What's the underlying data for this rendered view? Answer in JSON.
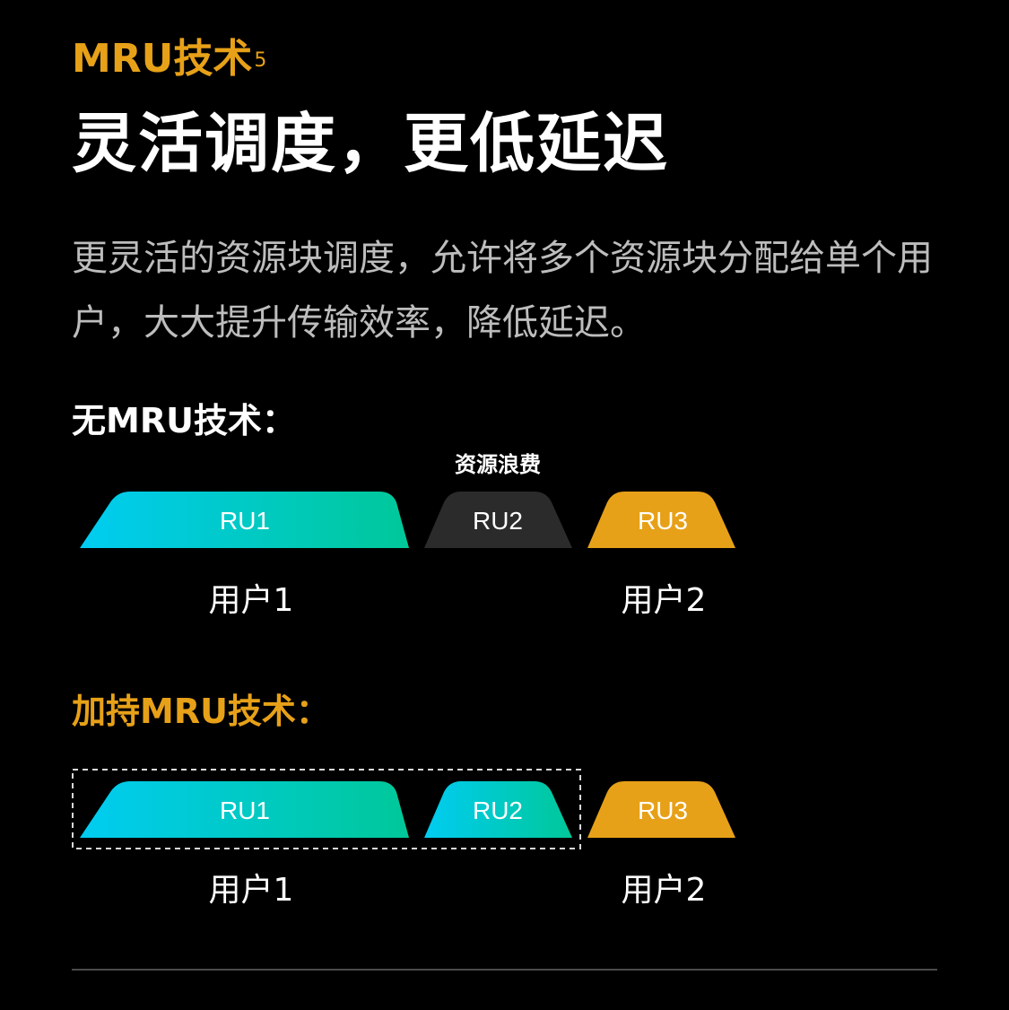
{
  "header": {
    "eyebrow": "MRU技术",
    "eyebrow_sup": "5",
    "headline": "灵活调度，更低延迟",
    "body": "更灵活的资源块调度，允许将多个资源块分配给单个用户，大大提升传输效率，降低延迟。"
  },
  "without_mru": {
    "title": "无MRU技术：",
    "waste_label": "资源浪费",
    "blocks": [
      {
        "label": "RU1",
        "style": "gradient"
      },
      {
        "label": "RU2",
        "style": "gray"
      },
      {
        "label": "RU3",
        "style": "orange"
      }
    ],
    "users": [
      "用户1",
      "用户2"
    ]
  },
  "with_mru": {
    "title": "加持MRU技术：",
    "blocks": [
      {
        "label": "RU1",
        "style": "gradient"
      },
      {
        "label": "RU2",
        "style": "gradient"
      },
      {
        "label": "RU3",
        "style": "orange"
      }
    ],
    "users": [
      "用户1",
      "用户2"
    ]
  },
  "colors": {
    "accent_orange": "#E7A118",
    "gradient_start": "#00CCF2",
    "gradient_end": "#00C899",
    "wasted_gray": "#2B2B2B"
  }
}
